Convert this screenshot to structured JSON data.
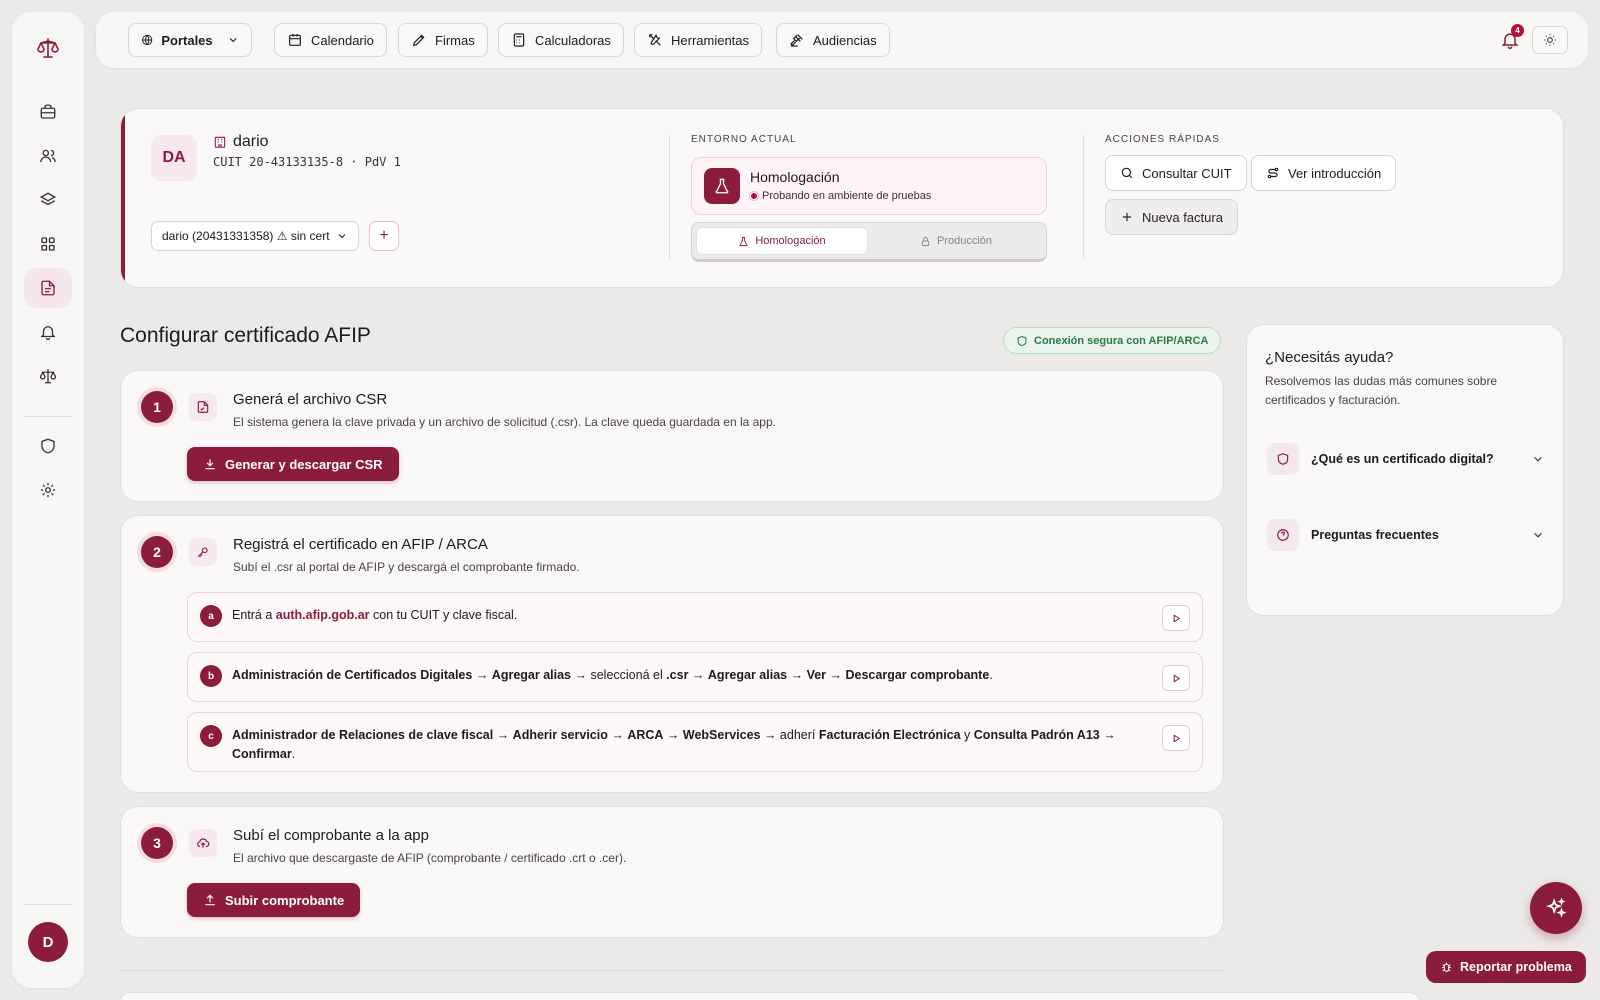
{
  "topbar": {
    "portales": "Portales",
    "calendario": "Calendario",
    "firmas": "Firmas",
    "calculadoras": "Calculadoras",
    "herramientas": "Herramientas",
    "audiencias": "Audiencias",
    "notif_count": "4"
  },
  "user": {
    "initials": "DA",
    "name": "dario",
    "cuit_line": "CUIT 20-43133135-8 · PdV 1",
    "account_select": "dario (20431331358) ⚠ sin cert",
    "add": "+"
  },
  "entorno": {
    "label": "ENTORNO ACTUAL",
    "title": "Homologación",
    "subtitle": "Probando en ambiente de pruebas",
    "opt_homologacion": "Homologación",
    "opt_produccion": "Producción"
  },
  "acciones": {
    "label": "ACCIONES RÁPIDAS",
    "consultar_cuit": "Consultar CUIT",
    "ver_intro": "Ver introducción",
    "nueva_factura": "Nueva factura"
  },
  "main": {
    "title": "Configurar certificado AFIP",
    "secure_badge": "Conexión segura con AFIP/ARCA"
  },
  "steps": [
    {
      "num": "1",
      "title": "Generá el archivo CSR",
      "desc": "El sistema genera la clave privada y un archivo de solicitud (.csr). La clave queda guardada en la app.",
      "button": "Generar y descargar CSR"
    },
    {
      "num": "2",
      "title": "Registrá el certificado en AFIP / ARCA",
      "desc": "Subí el .csr al portal de AFIP y descargá el comprobante firmado.",
      "substeps": [
        {
          "letter": "a",
          "pre": "Entrá a ",
          "link": "auth.afip.gob.ar",
          "post": " con tu CUIT y clave fiscal."
        },
        {
          "letter": "b",
          "b1": "Administración de Certificados Digitales",
          "t1": " → ",
          "b2": "Agregar alias",
          "t2": " → seleccioná el ",
          "b3": ".csr",
          "t3": " → ",
          "b4": "Agregar alias",
          "t4": " → ",
          "b5": "Ver",
          "t5": " → ",
          "b6": "Descargar comprobante",
          "t6": "."
        },
        {
          "letter": "c",
          "b1": "Administrador de Relaciones de clave fiscal",
          "t1": " → ",
          "b2": "Adherir servicio",
          "t2": " → ",
          "b3": "ARCA",
          "t3": " → ",
          "b4": "WebServices",
          "t4": " → adherí ",
          "b5": "Facturación Electrónica",
          "t5": " y ",
          "b6": "Consulta Padrón A13",
          "t6": " → ",
          "b7": "Confirmar",
          "t7": "."
        }
      ]
    },
    {
      "num": "3",
      "title": "Subí el comprobante a la app",
      "desc": "El archivo que descargaste de AFIP (comprobante / certificado .crt o .cer).",
      "button": "Subir comprobante"
    }
  ],
  "help": {
    "title": "¿Necesitás ayuda?",
    "desc": "Resolvemos las dudas más comunes sobre certificados y facturación.",
    "faq1": "¿Qué es un certificado digital?",
    "faq2": "Preguntas frecuentes"
  },
  "floating": {
    "report": "Reportar problema"
  },
  "sidebar": {
    "avatar": "D"
  },
  "colors": {
    "brand": "#8c1c3c",
    "background": "#ebeae8",
    "success": "#2a7a45"
  }
}
